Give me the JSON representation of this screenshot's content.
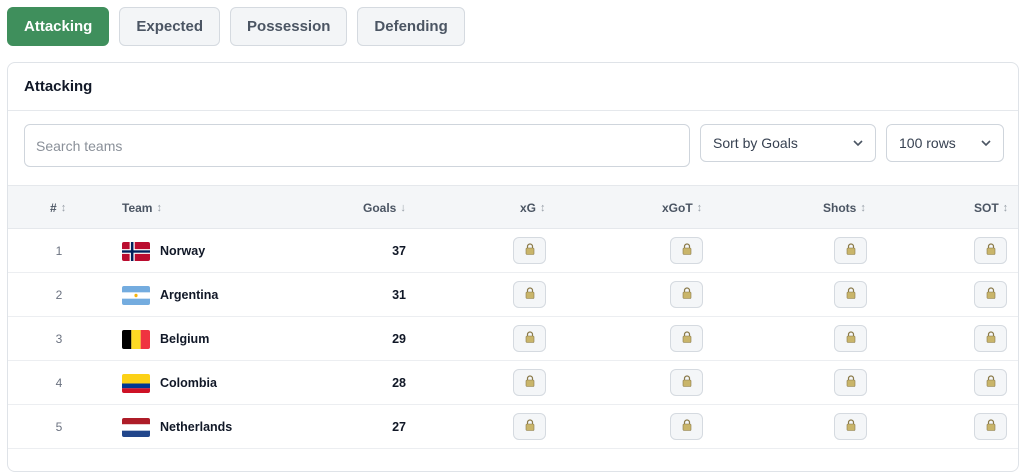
{
  "tabs": [
    {
      "label": "Attacking",
      "active": true
    },
    {
      "label": "Expected",
      "active": false
    },
    {
      "label": "Possession",
      "active": false
    },
    {
      "label": "Defending",
      "active": false
    }
  ],
  "card": {
    "title": "Attacking"
  },
  "search": {
    "placeholder": "Search teams"
  },
  "sort": {
    "selected": "Sort by Goals"
  },
  "rows_per_page": {
    "selected": "100 rows"
  },
  "columns": [
    {
      "label": "#",
      "sort": "↕"
    },
    {
      "label": "Team",
      "sort": "↕"
    },
    {
      "label": "Goals",
      "sort": "↓"
    },
    {
      "label": "xG",
      "sort": "↕"
    },
    {
      "label": "xGoT",
      "sort": "↕"
    },
    {
      "label": "Shots",
      "sort": "↕"
    },
    {
      "label": "SOT",
      "sort": "↕"
    }
  ],
  "rows": [
    {
      "rank": "1",
      "team": "Norway",
      "flag": "norway-flag-icon",
      "goals": "37"
    },
    {
      "rank": "2",
      "team": "Argentina",
      "flag": "argentina-flag-icon",
      "goals": "31"
    },
    {
      "rank": "3",
      "team": "Belgium",
      "flag": "belgium-flag-icon",
      "goals": "29"
    },
    {
      "rank": "4",
      "team": "Colombia",
      "flag": "colombia-flag-icon",
      "goals": "28"
    },
    {
      "rank": "5",
      "team": "Netherlands",
      "flag": "netherlands-flag-icon",
      "goals": "27"
    }
  ],
  "locked_cell_icon": "lock-icon",
  "colors": {
    "accent": "#3f8f5c",
    "header_bg": "#f4f6f8",
    "border": "#dfe3e8"
  }
}
